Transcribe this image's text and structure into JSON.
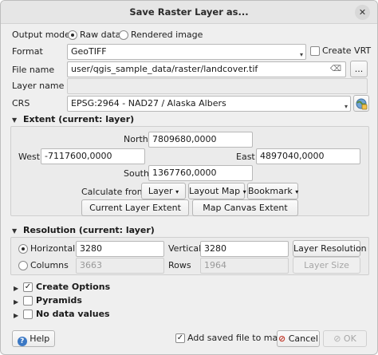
{
  "window": {
    "title": "Save Raster Layer as..."
  },
  "output_mode": {
    "label": "Output mode",
    "raw": "Raw data",
    "rendered": "Rendered image",
    "selected": "raw"
  },
  "format": {
    "label": "Format",
    "value": "GeoTIFF",
    "create_vrt": "Create VRT",
    "create_vrt_checked": false
  },
  "file_name": {
    "label": "File name",
    "value": "user/qgis_sample_data/raster/landcover.tif",
    "browse": "..."
  },
  "layer_name": {
    "label": "Layer name",
    "value": ""
  },
  "crs": {
    "label": "CRS",
    "value": "EPSG:2964 - NAD27 / Alaska Albers"
  },
  "extent": {
    "header": "Extent (current: layer)",
    "north_label": "North",
    "north": "7809680,0000",
    "west_label": "West",
    "west": "-7117600,0000",
    "east_label": "East",
    "east": "4897040,0000",
    "south_label": "South",
    "south": "1367760,0000",
    "calc_label": "Calculate from",
    "btn_layer": "Layer",
    "btn_layout": "Layout Map",
    "btn_bookmark": "Bookmark",
    "btn_current": "Current Layer Extent",
    "btn_canvas": "Map Canvas Extent"
  },
  "resolution": {
    "header": "Resolution (current: layer)",
    "horizontal_label": "Horizontal",
    "horizontal": "3280",
    "vertical_label": "Vertical",
    "vertical": "3280",
    "layer_res_btn": "Layer Resolution",
    "columns_label": "Columns",
    "columns": "3663",
    "rows_label": "Rows",
    "rows": "1964",
    "layer_size_btn": "Layer Size",
    "selected": "horizontal"
  },
  "sections": {
    "create_options": "Create Options",
    "create_options_checked": true,
    "pyramids": "Pyramids",
    "pyramids_checked": false,
    "no_data": "No data values",
    "no_data_checked": false
  },
  "footer": {
    "help": "Help",
    "add_saved": "Add saved file to map",
    "add_saved_checked": true,
    "cancel": "Cancel",
    "ok": "OK"
  }
}
